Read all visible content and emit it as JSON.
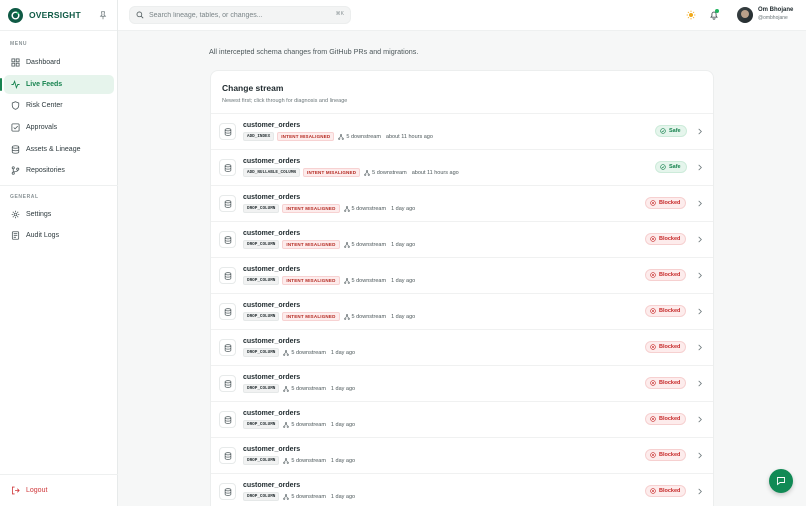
{
  "brand": {
    "name": "OVERSIGHT"
  },
  "sidebar": {
    "menu_label": "MENU",
    "general_label": "GENERAL",
    "items": [
      {
        "label": "Dashboard",
        "icon": "grid-icon"
      },
      {
        "label": "Live Feeds",
        "icon": "activity-icon",
        "active": true
      },
      {
        "label": "Risk Center",
        "icon": "shield-icon"
      },
      {
        "label": "Approvals",
        "icon": "check-square-icon"
      },
      {
        "label": "Assets & Lineage",
        "icon": "database-icon"
      },
      {
        "label": "Repositories",
        "icon": "git-branch-icon"
      }
    ],
    "general_items": [
      {
        "label": "Settings",
        "icon": "gear-icon"
      },
      {
        "label": "Audit Logs",
        "icon": "file-list-icon"
      }
    ],
    "logout_label": "Logout"
  },
  "topbar": {
    "search_placeholder": "Search lineage, tables, or changes...",
    "shortcut": "⌘K",
    "user_name": "Om Bhojane",
    "user_handle": "@ombhojane"
  },
  "main": {
    "intro": "All intercepted schema changes from GitHub PRs and migrations.",
    "card_title": "Change stream",
    "card_subtitle": "Newest first; click through for diagnosis and lineage"
  },
  "colors": {
    "accent": "#17834f",
    "brand": "#0f5a45",
    "blocked": "#c62828",
    "misaligned": "#b3261e"
  },
  "changes": [
    {
      "table": "customer_orders",
      "op": "ADD_INDEX",
      "intent": "INTENT MISALIGNED",
      "downstream": "5 downstream",
      "time": "about 11 hours ago",
      "status": "Safe"
    },
    {
      "table": "customer_orders",
      "op": "ADD_NULLABLE_COLUMN",
      "intent": "INTENT MISALIGNED",
      "downstream": "5 downstream",
      "time": "about 11 hours ago",
      "status": "Safe"
    },
    {
      "table": "customer_orders",
      "op": "DROP_COLUMN",
      "intent": "INTENT MISALIGNED",
      "downstream": "5 downstream",
      "time": "1 day ago",
      "status": "Blocked"
    },
    {
      "table": "customer_orders",
      "op": "DROP_COLUMN",
      "intent": "INTENT MISALIGNED",
      "downstream": "5 downstream",
      "time": "1 day ago",
      "status": "Blocked"
    },
    {
      "table": "customer_orders",
      "op": "DROP_COLUMN",
      "intent": "INTENT MISALIGNED",
      "downstream": "5 downstream",
      "time": "1 day ago",
      "status": "Blocked"
    },
    {
      "table": "customer_orders",
      "op": "DROP_COLUMN",
      "intent": "INTENT MISALIGNED",
      "downstream": "5 downstream",
      "time": "1 day ago",
      "status": "Blocked"
    },
    {
      "table": "customer_orders",
      "op": "DROP_COLUMN",
      "intent": "",
      "downstream": "5 downstream",
      "time": "1 day ago",
      "status": "Blocked"
    },
    {
      "table": "customer_orders",
      "op": "DROP_COLUMN",
      "intent": "",
      "downstream": "5 downstream",
      "time": "1 day ago",
      "status": "Blocked"
    },
    {
      "table": "customer_orders",
      "op": "DROP_COLUMN",
      "intent": "",
      "downstream": "5 downstream",
      "time": "1 day ago",
      "status": "Blocked"
    },
    {
      "table": "customer_orders",
      "op": "DROP_COLUMN",
      "intent": "",
      "downstream": "5 downstream",
      "time": "1 day ago",
      "status": "Blocked"
    },
    {
      "table": "customer_orders",
      "op": "DROP_COLUMN",
      "intent": "",
      "downstream": "5 downstream",
      "time": "1 day ago",
      "status": "Blocked"
    }
  ]
}
